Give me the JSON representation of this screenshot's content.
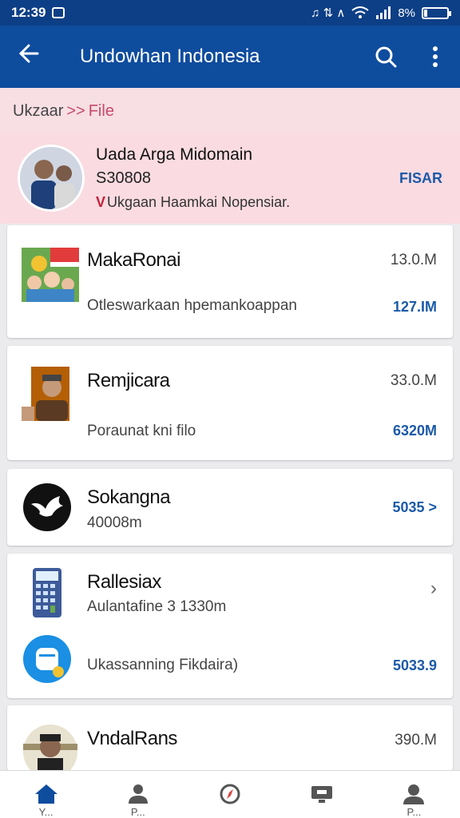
{
  "status_bar": {
    "time": "12:39",
    "icons_text": "♫ ⇅ ∧",
    "battery_text": "8%"
  },
  "app_bar": {
    "title": "Undowhan Indonesia"
  },
  "breadcrumb": {
    "parent": "Ukzaar",
    "separator": ">>",
    "current": "File"
  },
  "profile": {
    "name": "Uada  Arga Midomain",
    "subtitle": "S30808",
    "check_mark": "V",
    "description": "Ukgaan Haamkai Nopensiar.",
    "action_label": "FISAR"
  },
  "items": [
    {
      "title": "MakaRonai",
      "subtitle": "Otleswarkaan hpemankoappan",
      "value_top": "13.0.M",
      "value_bottom": "127.IM"
    },
    {
      "title": "Remjicara",
      "subtitle": "Poraunat kni filo",
      "value_top": "33.0.M",
      "value_bottom": "6320M"
    },
    {
      "title": "Sokangna",
      "subtitle": "40008m",
      "value_right": "5035 >"
    },
    {
      "title": "Rallesiax",
      "subtitle": "Aulantafine 3 1330m",
      "subtitle_2": "Ukassanning Fikdaira)",
      "value_bottom": "5033.9"
    },
    {
      "title": "VndalRans",
      "value_top": "390.M"
    }
  ],
  "bottom_nav": [
    {
      "icon": "home-icon",
      "label": "Y..."
    },
    {
      "icon": "people-icon",
      "label": "P..."
    },
    {
      "icon": "compass-icon",
      "label": ""
    },
    {
      "icon": "screen-icon",
      "label": ""
    },
    {
      "icon": "person-icon",
      "label": "P..."
    }
  ],
  "colors": {
    "app_bar": "#0e4c9e",
    "status_bar": "#0d3f86",
    "accent_blue": "#1c5aa8",
    "profile_bg": "#f9dbe1",
    "breadcrumb_accent": "#c64a6a"
  }
}
